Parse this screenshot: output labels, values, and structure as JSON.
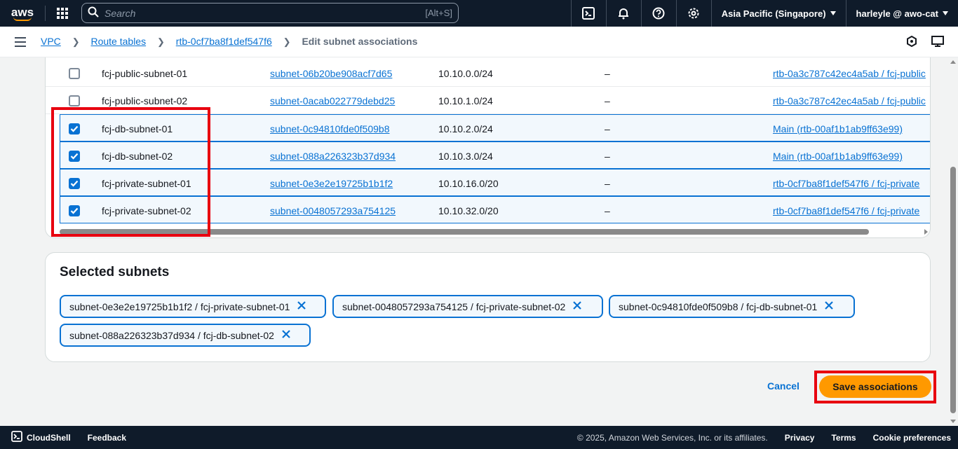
{
  "topnav": {
    "logo_text": "aws",
    "search_placeholder": "Search",
    "search_shortcut": "[Alt+S]",
    "region": "Asia Pacific (Singapore)",
    "account": "harleyle @ awo-cat"
  },
  "breadcrumb": {
    "items": [
      "VPC",
      "Route tables",
      "rtb-0cf7ba8f1def547f6"
    ],
    "current": "Edit subnet associations"
  },
  "table": {
    "rows": [
      {
        "name": "fcj-public-subnet-01",
        "subnet_id": "subnet-06b20be908acf7d65",
        "cidr": "10.10.0.0/24",
        "ipv6": "–",
        "route_table": "rtb-0a3c787c42ec4a5ab / fcj-public",
        "checked": false
      },
      {
        "name": "fcj-public-subnet-02",
        "subnet_id": "subnet-0acab022779debd25",
        "cidr": "10.10.1.0/24",
        "ipv6": "–",
        "route_table": "rtb-0a3c787c42ec4a5ab / fcj-public",
        "checked": false
      },
      {
        "name": "fcj-db-subnet-01",
        "subnet_id": "subnet-0c94810fde0f509b8",
        "cidr": "10.10.2.0/24",
        "ipv6": "–",
        "route_table": "Main (rtb-00af1b1ab9ff63e99)",
        "checked": true
      },
      {
        "name": "fcj-db-subnet-02",
        "subnet_id": "subnet-088a226323b37d934",
        "cidr": "10.10.3.0/24",
        "ipv6": "–",
        "route_table": "Main (rtb-00af1b1ab9ff63e99)",
        "checked": true
      },
      {
        "name": "fcj-private-subnet-01",
        "subnet_id": "subnet-0e3e2e19725b1b1f2",
        "cidr": "10.10.16.0/20",
        "ipv6": "–",
        "route_table": "rtb-0cf7ba8f1def547f6 / fcj-private",
        "checked": true
      },
      {
        "name": "fcj-private-subnet-02",
        "subnet_id": "subnet-0048057293a754125",
        "cidr": "10.10.32.0/20",
        "ipv6": "–",
        "route_table": "rtb-0cf7ba8f1def547f6 / fcj-private",
        "checked": true
      }
    ]
  },
  "selected": {
    "title": "Selected subnets",
    "tokens": [
      "subnet-0e3e2e19725b1b1f2 / fcj-private-subnet-01",
      "subnet-0048057293a754125 / fcj-private-subnet-02",
      "subnet-0c94810fde0f509b8 / fcj-db-subnet-01",
      "subnet-088a226323b37d934 / fcj-db-subnet-02"
    ]
  },
  "actions": {
    "cancel": "Cancel",
    "save": "Save associations"
  },
  "footer": {
    "cloudshell": "CloudShell",
    "feedback": "Feedback",
    "copyright": "© 2025, Amazon Web Services, Inc. or its affiliates.",
    "privacy": "Privacy",
    "terms": "Terms",
    "cookies": "Cookie preferences"
  },
  "colors": {
    "nav_bg": "#0f1b2a",
    "link": "#0972d3",
    "primary_button": "#ff9900",
    "highlight_red": "#e8000f"
  }
}
